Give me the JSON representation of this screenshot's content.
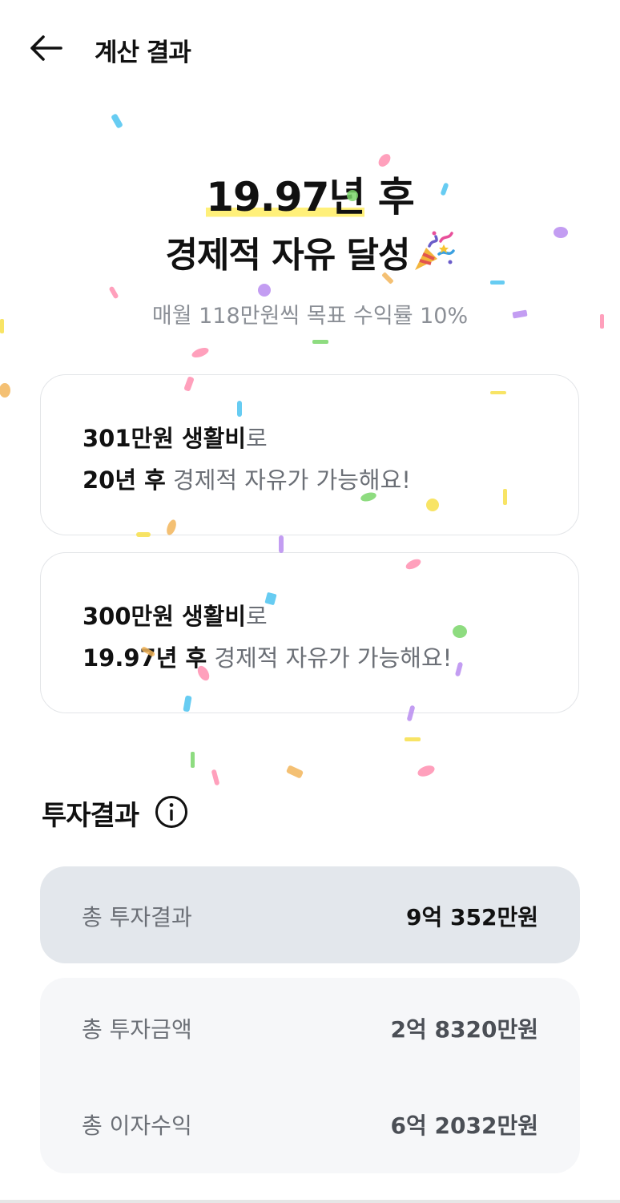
{
  "header": {
    "title": "계산 결과"
  },
  "hero": {
    "years": "19.97년",
    "after": " 후",
    "achievement": "경제적 자유 달성",
    "subtitle": "매월 118만원씩 목표 수익률 10%"
  },
  "scenarios": [
    {
      "amount": "301만원 생활비",
      "suffix": "로",
      "years": "20년 후",
      "message": " 경제적 자유가 가능해요!"
    },
    {
      "amount": "300만원 생활비",
      "suffix": "로",
      "years": "19.97년 후",
      "message": " 경제적 자유가 가능해요!"
    }
  ],
  "investment": {
    "title": "투자결과",
    "total_result_label": "총 투자결과",
    "total_result_value": "9억 352만원",
    "total_invested_label": "총 투자금액",
    "total_invested_value": "2억 8320만원",
    "total_interest_label": "총 이자수익",
    "total_interest_value": "6억 2032만원"
  },
  "icons": [
    "back-arrow-icon",
    "party-popper-icon",
    "info-icon"
  ],
  "colors": {
    "highlight": "#fff07a",
    "total_box": "#e3e7ec",
    "sub_box": "#f6f7f9"
  }
}
